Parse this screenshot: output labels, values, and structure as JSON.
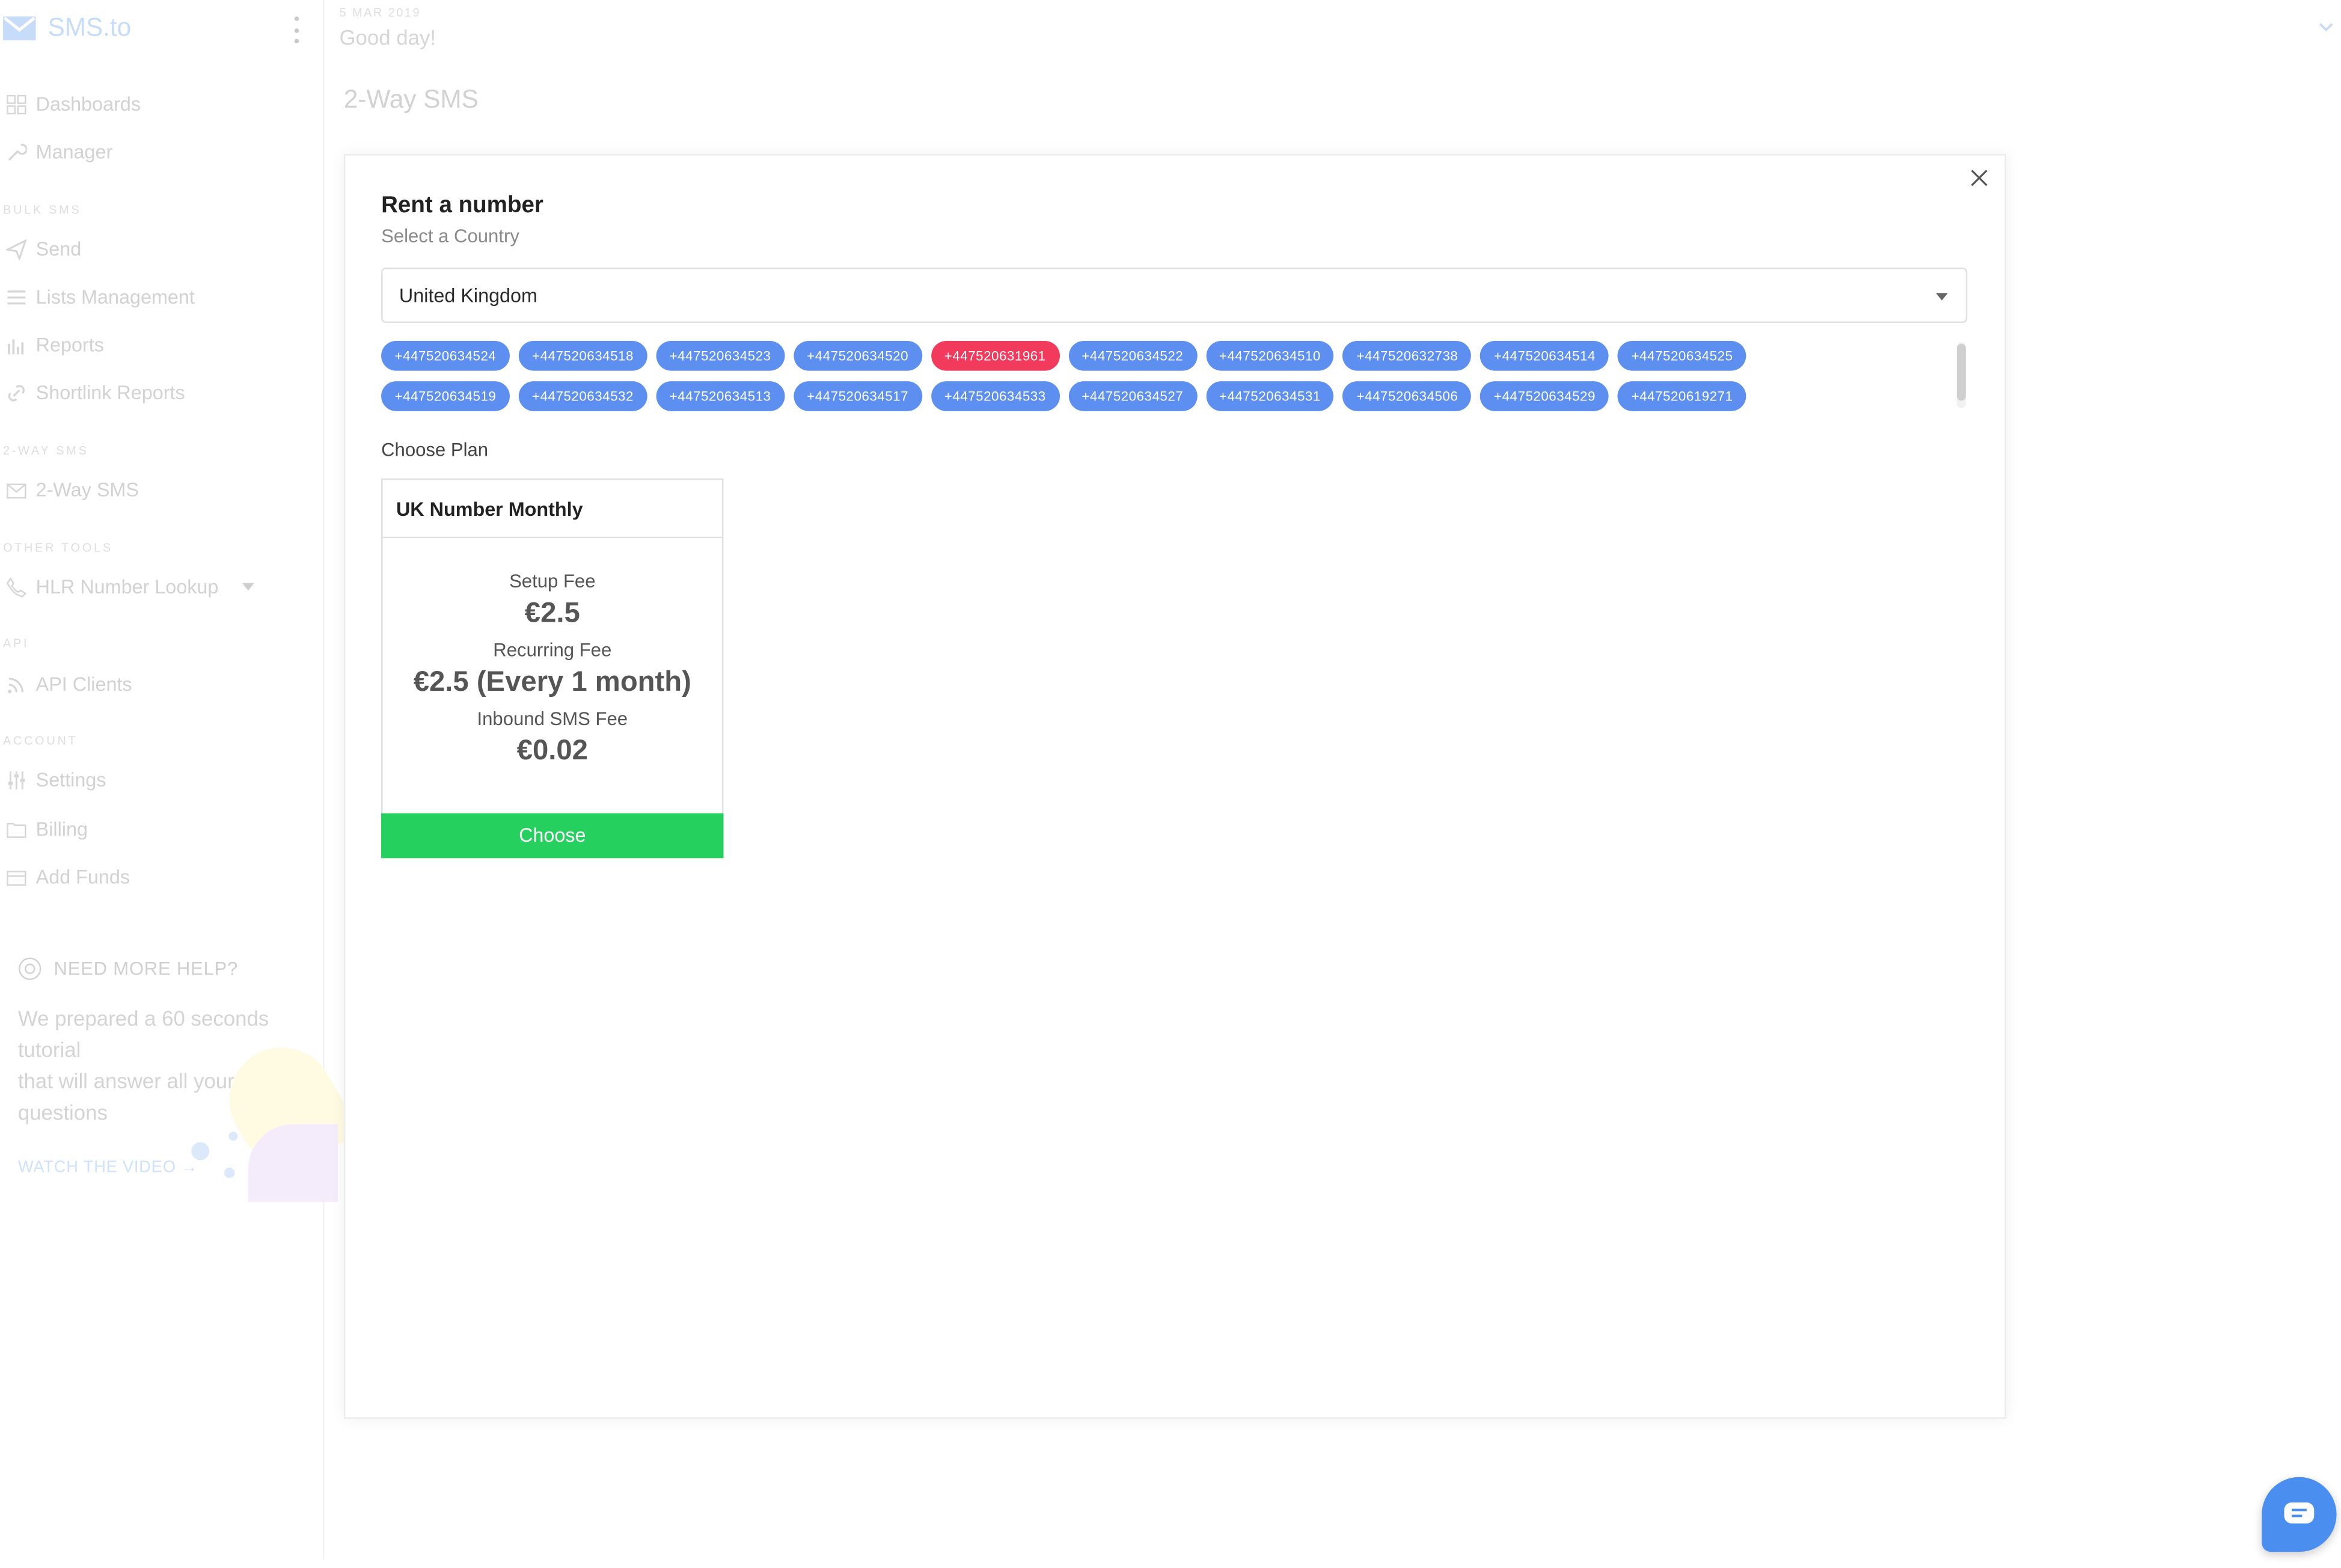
{
  "brand": {
    "logo_text": "SMS.to"
  },
  "header": {
    "date": "5 MAR 2019",
    "greeting": "Good day!"
  },
  "page": {
    "title": "2-Way SMS"
  },
  "sidebar": {
    "items": [
      {
        "label": "Dashboards"
      },
      {
        "label": "Manager"
      },
      {
        "section": "BULK SMS"
      },
      {
        "label": "Send"
      },
      {
        "label": "Lists Management"
      },
      {
        "label": "Reports"
      },
      {
        "label": "Shortlink Reports"
      },
      {
        "section": "2-WAY SMS"
      },
      {
        "label": "2-Way SMS"
      },
      {
        "section": "OTHER TOOLS"
      },
      {
        "label": "HLR Number Lookup"
      },
      {
        "section": "API"
      },
      {
        "label": "API Clients"
      },
      {
        "section": "ACCOUNT"
      },
      {
        "label": "Settings"
      },
      {
        "label": "Billing"
      },
      {
        "label": "Add Funds"
      }
    ],
    "help": {
      "title": "NEED MORE HELP?",
      "line1": "We prepared a 60 seconds",
      "line2": "tutorial",
      "line3": "that will answer all your",
      "line4": "questions",
      "link": "WATCH THE VIDEO →"
    }
  },
  "modal": {
    "title": "Rent a number",
    "subtitle": "Select a Country",
    "country": "United Kingdom",
    "numbers_row1": [
      "+447520634524",
      "+447520634518",
      "+447520634523",
      "+447520634520",
      "+447520631961",
      "+447520634522",
      "+447520634510",
      "+447520632738",
      "+447520634514",
      "+447520634525"
    ],
    "numbers_row2": [
      "+447520634519",
      "+447520634532",
      "+447520634513",
      "+447520634517",
      "+447520634533",
      "+447520634527",
      "+447520634531",
      "+447520634506",
      "+447520634529",
      "+447520619271"
    ],
    "selected_number": "+447520631961",
    "choose_plan_label": "Choose Plan",
    "plan": {
      "name": "UK Number Monthly",
      "setup_label": "Setup Fee",
      "setup_value": "€2.5",
      "recurring_label": "Recurring Fee",
      "recurring_value": "€2.5 (Every 1 month)",
      "inbound_label": "Inbound SMS Fee",
      "inbound_value": "€0.02",
      "button": "Choose"
    }
  },
  "colors": {
    "chip": "#5c8ff0",
    "chip_selected": "#f23a5c",
    "choose": "#25d05e",
    "chat": "#4a8ff0"
  }
}
